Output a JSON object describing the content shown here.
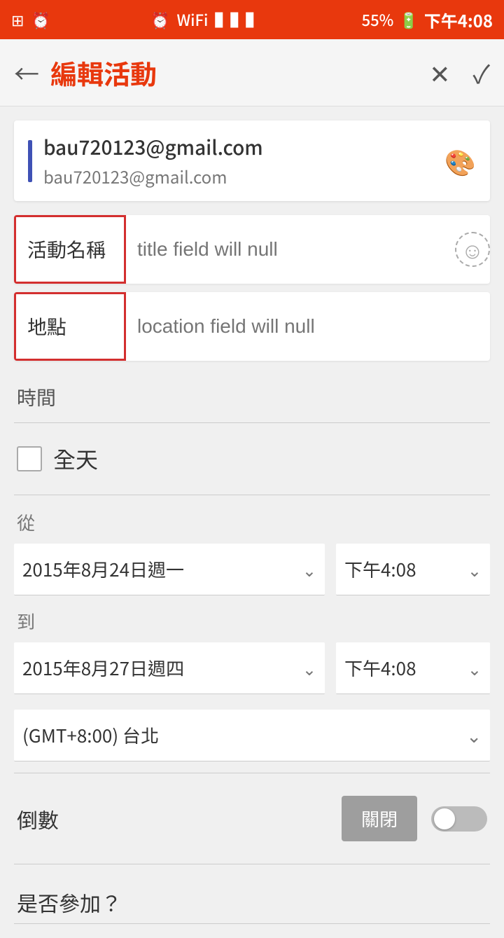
{
  "statusBar": {
    "leftIcons": [
      "grid",
      "alarm"
    ],
    "centerIcons": [
      "alarm-clock",
      "wifi",
      "signal"
    ],
    "battery": "55%",
    "time": "下午4:08"
  },
  "appBar": {
    "backIcon": "←",
    "title": "編輯活動",
    "closeIcon": "✕",
    "checkIcon": "✓"
  },
  "account": {
    "colorBar": "#3f51b5",
    "name": "bau720123@gmail.com",
    "email": "bau720123@gmail.com",
    "paletteIcon": "🎨"
  },
  "fields": {
    "titleLabel": "活動名稱",
    "titlePlaceholder": "title field will null",
    "locationLabel": "地點",
    "locationPlaceholder": "location field will null",
    "smileyIcon": "☺"
  },
  "time": {
    "sectionLabel": "時間",
    "allDayLabel": "全天",
    "fromLabel": "從",
    "fromDate": "2015年8月24日週一",
    "fromTime": "下午4:08",
    "toLabel": "到",
    "toDate": "2015年8月27日週四",
    "toTime": "下午4:08",
    "timezone": "(GMT+8:00) 台北",
    "chevron": "⌄"
  },
  "countdown": {
    "label": "倒數",
    "toggleLabel": "關閉"
  },
  "participate": {
    "label": "是否參加？"
  }
}
